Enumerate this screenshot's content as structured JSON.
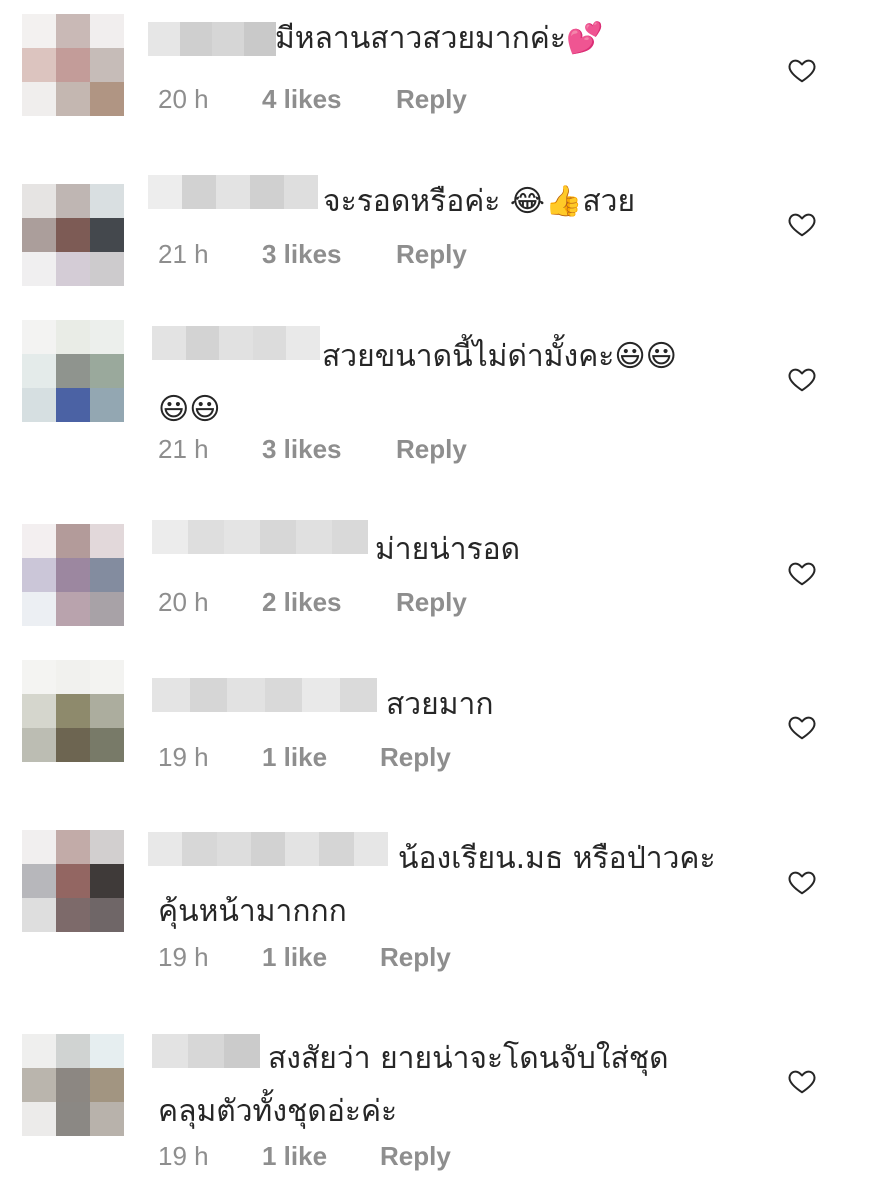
{
  "comments": [
    {
      "text": "มีหลานสาวสวยมากค่ะ💕",
      "time": "20 h",
      "likes": "4 likes",
      "reply": "Reply"
    },
    {
      "text": "จะรอดหรือค่ะ 😂👍สวย",
      "time": "21 h",
      "likes": "3 likes",
      "reply": "Reply"
    },
    {
      "text": "สวยขนาดนี้ไม่ด่ามั้งคะ😃😃\n😃😃",
      "time": "21 h",
      "likes": "3 likes",
      "reply": "Reply"
    },
    {
      "text": "ม่ายน่ารอด",
      "time": "20 h",
      "likes": "2 likes",
      "reply": "Reply"
    },
    {
      "text": "สวยมาก",
      "time": "19 h",
      "likes": "1 like",
      "reply": "Reply"
    },
    {
      "text": "น้องเรียน.มธ หรือป่าวคะ\nคุ้นหน้ามากกก",
      "time": "19 h",
      "likes": "1 like",
      "reply": "Reply"
    },
    {
      "text": "สงสัยว่า ยายน่าจะโดนจับใส่ชุด\nคลุมตัวทั้งชุดอ่ะค่ะ",
      "time": "19 h",
      "likes": "1 like",
      "reply": "Reply"
    }
  ],
  "icons": {
    "like": "heart-outline-icon"
  },
  "colors": {
    "text": "#262626",
    "secondary": "#8e8e8e"
  }
}
